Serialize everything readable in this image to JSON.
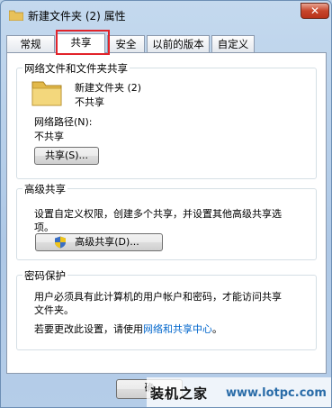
{
  "window": {
    "title": "新建文件夹 (2) 属性",
    "close_label": "✕"
  },
  "tabs": [
    {
      "label": "常规"
    },
    {
      "label": "共享"
    },
    {
      "label": "安全"
    },
    {
      "label": "以前的版本"
    },
    {
      "label": "自定义"
    }
  ],
  "network_share": {
    "group_title": "网络文件和文件夹共享",
    "folder_name": "新建文件夹 (2)",
    "folder_status": "不共享",
    "path_label": "网络路径(N):",
    "path_value": "不共享",
    "share_button": "共享(S)..."
  },
  "advanced_share": {
    "group_title": "高级共享",
    "description_line1": "设置自定义权限，创建多个共享，并设置其他高级共享选",
    "description_line2": "项。",
    "button_label": "高级共享(D)..."
  },
  "password": {
    "group_title": "密码保护",
    "line1": "用户必须具有此计算机的用户帐户和密码，才能访问共享",
    "line2": "文件夹。",
    "change_prefix": "若要更改此设置，请使用",
    "change_link": "网络和共享中心",
    "change_suffix": "。"
  },
  "footer": {
    "ok_partial": "确"
  },
  "watermark": {
    "text": "装机之家",
    "url": "www.lotpc.com"
  },
  "colors": {
    "highlight": "#e2232a",
    "link": "#0066cc",
    "close": "#c7452b"
  }
}
